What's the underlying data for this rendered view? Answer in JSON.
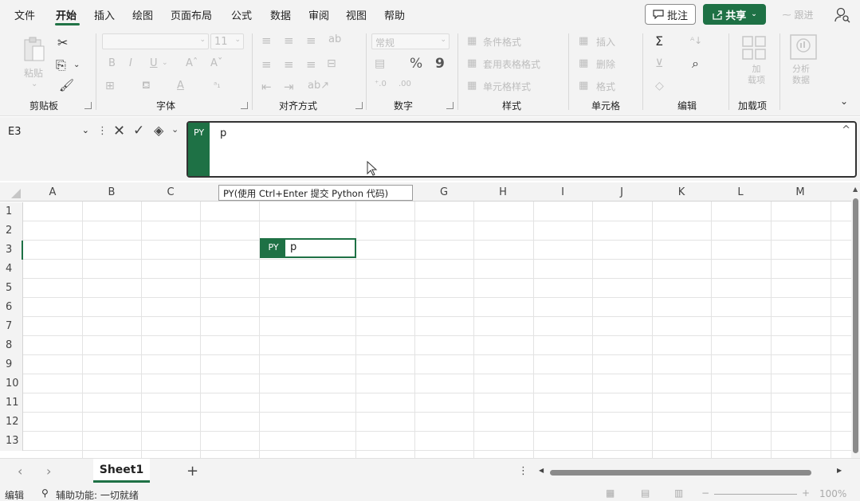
{
  "tabs": [
    "文件",
    "开始",
    "插入",
    "绘图",
    "页面布局",
    "公式",
    "数据",
    "审阅",
    "视图",
    "帮助"
  ],
  "header": {
    "comment_label": "批注",
    "share_label": "共享",
    "catchup_label": "跟进"
  },
  "ribbon": {
    "clipboard": {
      "paste_label": "粘贴",
      "group_label": "剪贴板"
    },
    "font": {
      "font_name": "",
      "font_size": "11",
      "bold": "B",
      "italic": "I",
      "underline": "U",
      "grow": "Aˆ",
      "shrink": "Aˇ",
      "font_color": "A",
      "group_label": "字体"
    },
    "alignment": {
      "group_label": "对齐方式"
    },
    "number": {
      "format": "常规",
      "percent": "%",
      "comma": "9",
      "group_label": "数字"
    },
    "styles": {
      "conditional": "条件格式",
      "table": "套用表格格式",
      "cell": "单元格样式",
      "group_label": "样式"
    },
    "cells": {
      "insert": "插入",
      "delete": "删除",
      "format": "格式",
      "group_label": "单元格"
    },
    "editing": {
      "sum": "Σ",
      "group_label": "编辑"
    },
    "addins": {
      "label": "加\n载项",
      "group_label": "加载项"
    },
    "analysis": {
      "label": "分析\n数据"
    }
  },
  "formula_bar": {
    "name_box": "E3",
    "py_badge": "PY",
    "text": "p"
  },
  "grid": {
    "columns": [
      "A",
      "B",
      "C",
      "D",
      "E",
      "F",
      "G",
      "H",
      "I",
      "J",
      "K",
      "L",
      "M"
    ],
    "rows": [
      "1",
      "2",
      "3",
      "4",
      "5",
      "6",
      "7",
      "8",
      "9",
      "10",
      "11",
      "12",
      "13"
    ],
    "active_cell": {
      "py_badge": "PY",
      "value": "p"
    },
    "tooltip": "PY(使用 Ctrl+Enter 提交 Python 代码)"
  },
  "sheets": {
    "active": "Sheet1",
    "add": "+"
  },
  "status": {
    "mode": "编辑",
    "accessibility": "辅助功能: 一切就绪",
    "zoom": "100%"
  },
  "colors": {
    "accent": "#1e7145",
    "ribbon_bg": "#f3f3f3"
  }
}
